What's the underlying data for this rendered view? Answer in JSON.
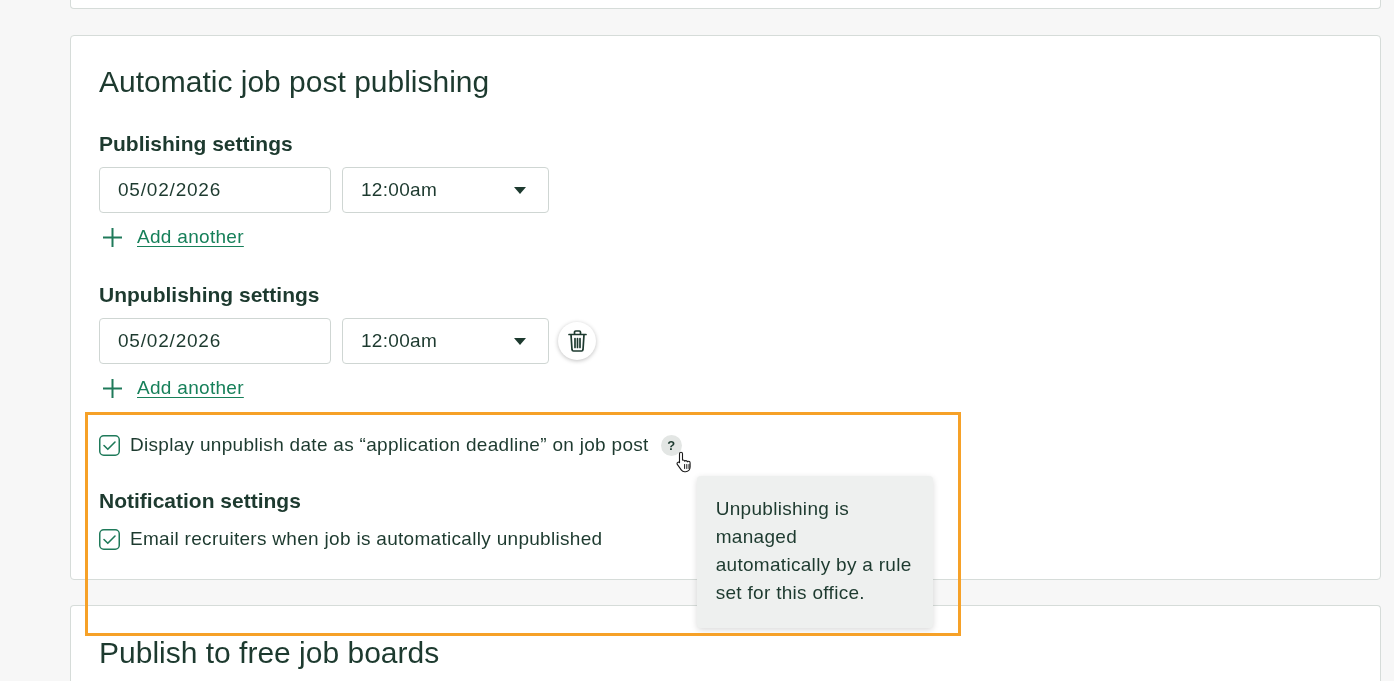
{
  "automatic_publishing": {
    "title": "Automatic job post publishing",
    "sections": [
      {
        "heading": "Publishing settings",
        "schedules": [
          {
            "date": "05/02/2026",
            "time": "12:00am",
            "removable": false
          }
        ],
        "add_link": "Add another"
      },
      {
        "heading": "Unpublishing settings",
        "schedules": [
          {
            "date": "05/02/2026",
            "time": "12:00am",
            "removable": true
          }
        ],
        "add_link": "Add another"
      }
    ],
    "options": [
      {
        "label": "Display unpublish date as “application deadline” on job post",
        "checked": true,
        "help": "?"
      }
    ],
    "notification_settings": {
      "heading": "Notification settings",
      "options": [
        {
          "label": "Email recruiters when job is automatically unpublished",
          "checked": true
        }
      ]
    }
  },
  "tooltip": {
    "text": "Unpublishing is managed automatically by a rule set for this office."
  },
  "cursor": {
    "kind": "pointer"
  },
  "next_card": {
    "title": "Publish to free job boards"
  },
  "annotations": [
    {
      "kind": "highlight"
    }
  ]
}
